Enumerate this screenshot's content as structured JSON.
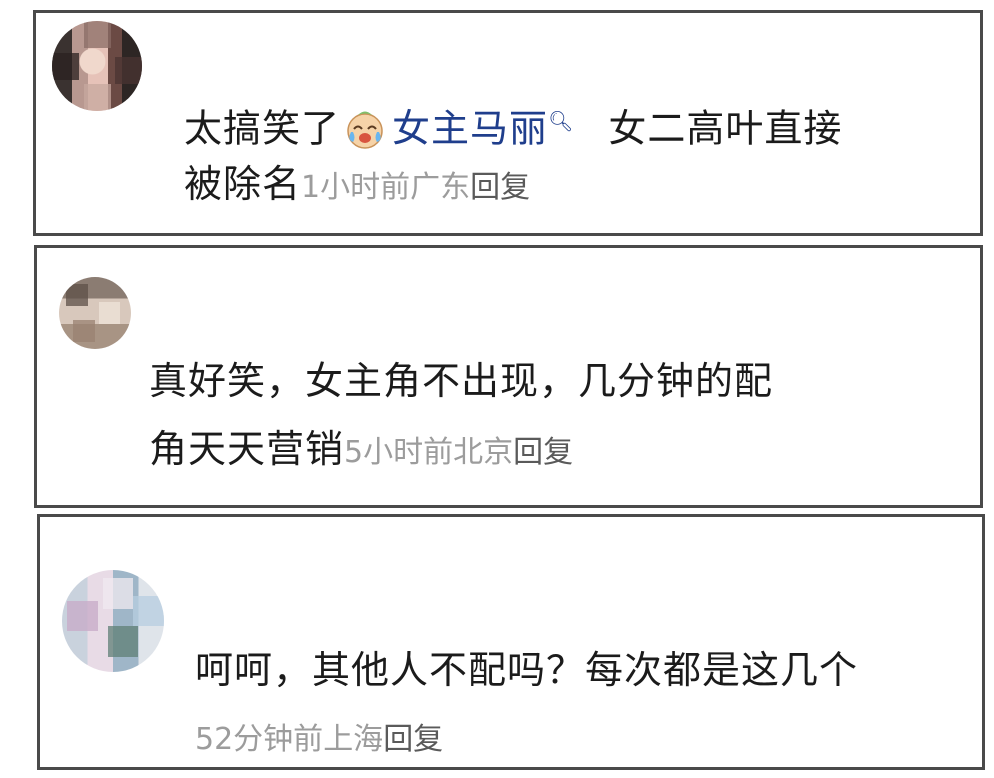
{
  "comments": [
    {
      "text_before_emoji": "太搞笑了",
      "emoji_icon": "laughing-crying-face-icon",
      "mention": "女主马丽",
      "mention_suffix": "q",
      "text_line1_after": "女二高叶直接",
      "text_line2": "被除名",
      "time": "1小时前",
      "location": "广东",
      "reply_label": "回复"
    },
    {
      "text_line1": "真好笑，女主角不出现，几分钟的配",
      "text_line2": "角天天营销",
      "time": "5小时前",
      "location": "北京",
      "reply_label": "回复"
    },
    {
      "text_line1": "呵呵，其他人不配吗？每次都是这几个",
      "time": "52分钟前",
      "location": "上海",
      "reply_label": "回复"
    }
  ],
  "colors": {
    "text": "#1b1b1b",
    "meta": "#9c9c9c",
    "mention": "#1f3e8c",
    "border": "#4a4a4a"
  }
}
